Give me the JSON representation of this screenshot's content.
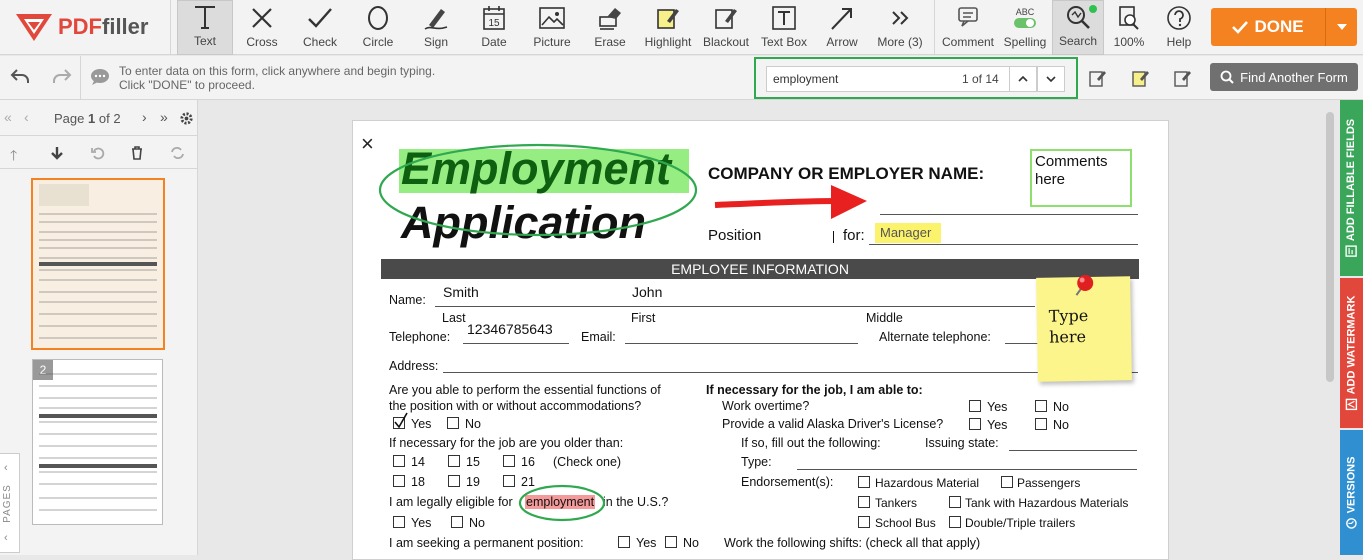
{
  "app": {
    "logo_text_pdf": "PDF",
    "logo_text_rest": "filler"
  },
  "toolbar": {
    "tools": [
      {
        "id": "text",
        "label": "Text",
        "icon": "text-T-icon"
      },
      {
        "id": "cross",
        "label": "Cross",
        "icon": "cross-icon"
      },
      {
        "id": "check",
        "label": "Check",
        "icon": "check-icon"
      },
      {
        "id": "circle",
        "label": "Circle",
        "icon": "circle-icon"
      },
      {
        "id": "sign",
        "label": "Sign",
        "icon": "pen-icon"
      },
      {
        "id": "date",
        "label": "Date",
        "icon": "calendar-icon"
      },
      {
        "id": "picture",
        "label": "Picture",
        "icon": "picture-icon"
      },
      {
        "id": "erase",
        "label": "Erase",
        "icon": "eraser-icon"
      },
      {
        "id": "highlight",
        "label": "Highlight",
        "icon": "highlight-icon"
      },
      {
        "id": "blackout",
        "label": "Blackout",
        "icon": "blackout-icon"
      },
      {
        "id": "textbox",
        "label": "Text Box",
        "icon": "textbox-icon"
      },
      {
        "id": "arrow",
        "label": "Arrow",
        "icon": "arrow-icon"
      },
      {
        "id": "more",
        "label": "More (3)",
        "icon": "chevrons-right-icon"
      }
    ],
    "right_tools": [
      {
        "id": "comment",
        "label": "Comment"
      },
      {
        "id": "spelling",
        "label": "Spelling",
        "caption": "ABC"
      },
      {
        "id": "search",
        "label": "Search"
      },
      {
        "id": "zoom",
        "label": "100%"
      },
      {
        "id": "help",
        "label": "Help"
      }
    ],
    "done_label": "DONE",
    "date_glyph": "15"
  },
  "subbar": {
    "hint_line1": "To enter data on this form, click anywhere and begin typing.",
    "hint_line2": "Click \"DONE\" to proceed.",
    "search_value": "employment",
    "search_count": "1 of 14",
    "find_another_form": "Find Another Form"
  },
  "pager": {
    "page_label": "Page",
    "current": "1",
    "of": "of",
    "total": "2"
  },
  "thumbnails": [
    {
      "num": "1",
      "selected": true
    },
    {
      "num": "2",
      "selected": false
    }
  ],
  "pages_tab": "PAGES",
  "side_tabs": [
    {
      "label": "ADD FILLABLE FIELDS",
      "color": "#3aa65a"
    },
    {
      "label": "ADD WATERMARK",
      "color": "#e2473b"
    },
    {
      "label": "VERSIONS",
      "color": "#2f8fd0"
    }
  ],
  "doc": {
    "title1": "Employment",
    "title2": "Application",
    "company_label": "COMPANY OR EMPLOYER NAME:",
    "comments_box": "Comments here",
    "position_label": "Position",
    "for_label": "for:",
    "position_value": "Manager",
    "section_employee": "EMPLOYEE INFORMATION",
    "name_label": "Name:",
    "last_value": "Smith",
    "first_value": "John",
    "last_label": "Last",
    "first_label": "First",
    "middle_label": "Middle",
    "telephone_label": "Telephone:",
    "telephone_value": "12346785643",
    "email_label": "Email:",
    "alt_phone_label": "Alternate telephone:",
    "address_label": "Address:",
    "sticky": "Type here",
    "q_essential": "Are you able to perform the essential functions of",
    "q_essential2": "the position with or without accommodations?",
    "yes": "Yes",
    "no": "No",
    "q_older": "If necessary for the job are you older than:",
    "ages": [
      "14",
      "15",
      "16",
      "18",
      "19",
      "21"
    ],
    "check_one": "(Check one)",
    "q_eligible_pre": "I am legally eligible for",
    "q_eligible_hl": "employment",
    "q_eligible_post": "in the U.S.?",
    "q_permanent": "I am seeking a permanent position:",
    "r_header": "If necessary for the job, I am able to:",
    "r_overtime": "Work overtime?",
    "r_license": "Provide a valid Alaska Driver's License?",
    "r_fillout": "If so, fill out the following:",
    "r_issuing": "Issuing state:",
    "r_type": "Type:",
    "r_endorse": "Endorsement(s):",
    "endorsements": [
      "Hazardous Material",
      "Passengers",
      "Tankers",
      "Tank with Hazardous Materials",
      "School Bus",
      "Double/Triple trailers"
    ],
    "r_shifts": "Work the following shifts: (check all that apply)",
    "close_glyph": "×"
  }
}
